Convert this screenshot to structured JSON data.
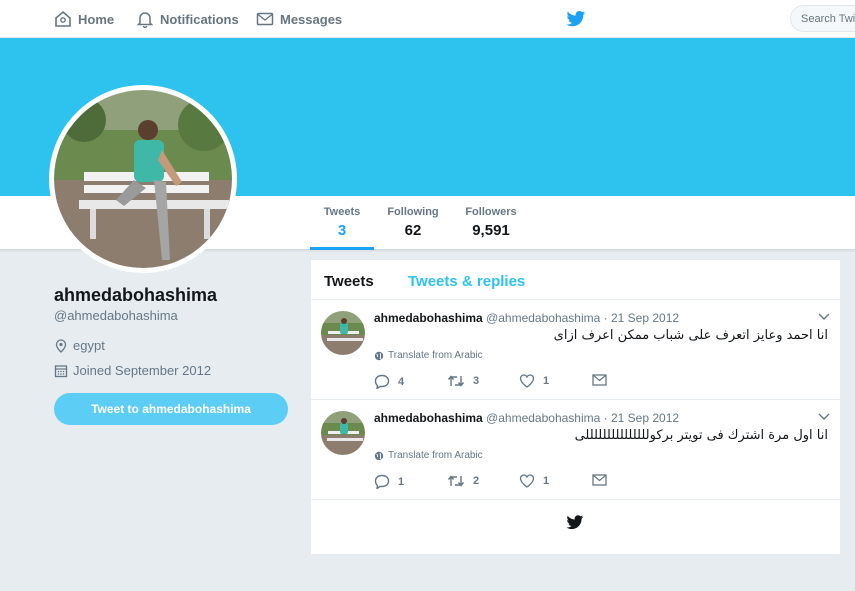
{
  "topnav": {
    "home": "Home",
    "notifications": "Notifications",
    "messages": "Messages",
    "search_placeholder": "Search Twitter",
    "twitter_blue": "#1da1f2"
  },
  "profile": {
    "banner_color": "#2ec2ef",
    "name": "ahmedabohashima",
    "handle": "@ahmedabohashima",
    "location": "egypt",
    "joined": "Joined September 2012",
    "tweet_to_button": "Tweet to ahmedabohashima"
  },
  "stats": {
    "tweets_label": "Tweets",
    "tweets_value": "3",
    "following_label": "Following",
    "following_value": "62",
    "followers_label": "Followers",
    "followers_value": "9,591"
  },
  "timeline": {
    "tabs": [
      "Tweets",
      "Tweets & replies"
    ],
    "active_tab": "Tweets",
    "tweets": [
      {
        "name": "ahmedabohashima",
        "handle": "@ahmedabohashima",
        "date": "· 21 Sep 2012",
        "text": "انا احمد وعايز اتعرف على شباب ممكن اعرف ازاى",
        "translate": "Translate from Arabic",
        "replies": "4",
        "retweets": "3",
        "likes": "1"
      },
      {
        "name": "ahmedabohashima",
        "handle": "@ahmedabohashima",
        "date": "· 21 Sep 2012",
        "text": "انا اول مرة اشترك فى تويتر بركولللللللللللللللى",
        "translate": "Translate from Arabic",
        "replies": "1",
        "retweets": "2",
        "likes": "1"
      }
    ]
  }
}
